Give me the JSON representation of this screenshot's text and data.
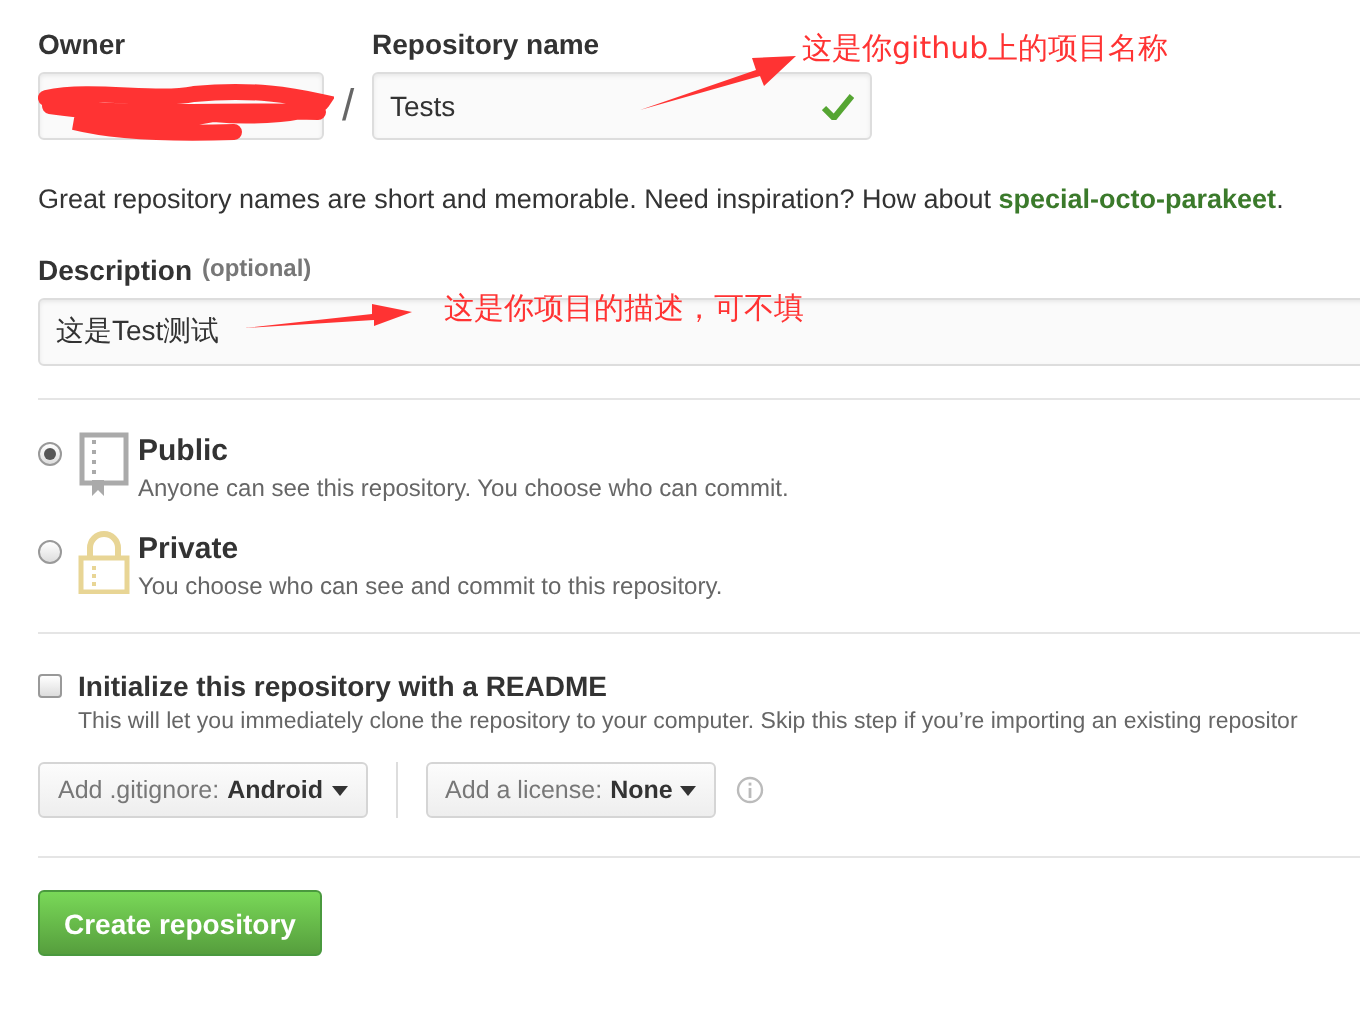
{
  "owner": {
    "label": "Owner",
    "separator": "/"
  },
  "repository_name": {
    "label": "Repository name",
    "value": "Tests",
    "valid": true
  },
  "name_hint": "Great repository names are short and memorable. Need inspiration? How about **special-octo-parakeet**.",
  "description": {
    "label": "Description",
    "optional": "(optional)",
    "value": "这是Test测试"
  },
  "visibility": [
    {
      "kind": "public",
      "label": "Public",
      "note": "Anyone can see this repository. You choose who can commit.",
      "selected": true
    },
    {
      "kind": "private",
      "label": "Private",
      "note": "You choose who can see and commit to this repository.",
      "selected": false
    }
  ],
  "readme": {
    "label": "Initialize this repository with a README",
    "note": "This will let you immediately clone the repository to your computer. Skip this step if you’re importing an existing repositor",
    "checked": false
  },
  "dropdowns": [
    {
      "prefix": "Add .gitignore:",
      "value": "Android"
    },
    {
      "prefix": "Add a license:",
      "value": "None"
    }
  ],
  "submit": "Create repository",
  "annotations": [
    {
      "kind": "name",
      "text": "这是你github上的项目名称"
    },
    {
      "kind": "description",
      "text": "这是你项目的描述，可不填"
    }
  ]
}
